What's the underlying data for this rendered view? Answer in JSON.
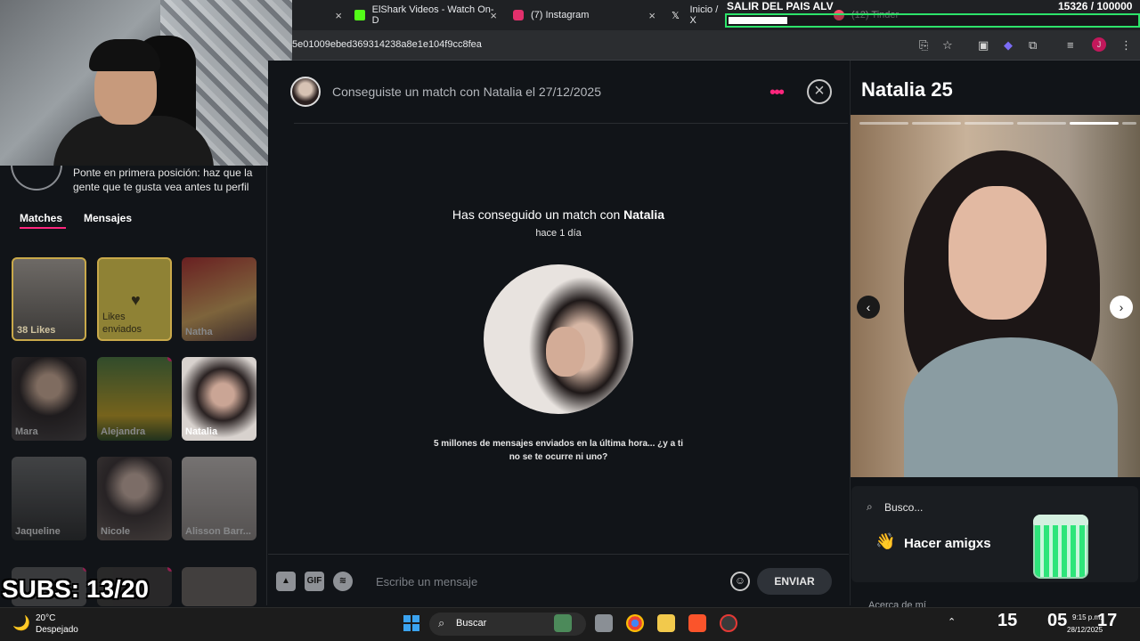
{
  "browser": {
    "tabs": [
      {
        "label": "ElShark Videos - Watch On-D",
        "icon_color": "#53fc18"
      },
      {
        "label": "(7) Instagram",
        "icon_color": "#e1306c"
      },
      {
        "label": "Inicio / X",
        "icon_color": "#ffffff"
      },
      {
        "label": "(12) Tinder",
        "icon_color": "#fd5068"
      }
    ],
    "url": "5e01009ebed369314238a8e1e104f9cc8fea"
  },
  "overlay": {
    "goal_title": "SALIR DEL PAIS ALV",
    "goal_count": "15326 / 100000",
    "goal_progress": 0.15326,
    "subs": "SUBS: 13/20"
  },
  "sidebar": {
    "promo_text": "Ponte en primera posición: haz que la gente que te gusta vea antes tu perfil",
    "tabs": {
      "matches": "Matches",
      "messages": "Mensajes"
    },
    "cards": [
      {
        "label": "38 Likes"
      },
      {
        "label": "Likes enviados"
      },
      {
        "label": "Natha"
      },
      {
        "label": "Mara"
      },
      {
        "label": "Alejandra"
      },
      {
        "label": "Natalia"
      },
      {
        "label": "Jaqueline"
      },
      {
        "label": "Nicole"
      },
      {
        "label": "Alisson Barr..."
      }
    ]
  },
  "chat": {
    "header": "Conseguiste un match con Natalia el 27/12/2025",
    "title_prefix": "Has conseguido un match con ",
    "title_name": "Natalia",
    "time": "hace 1 día",
    "hint": "5 millones de mensajes enviados en la última hora... ¿y a ti no se te ocurre ni uno?",
    "composer": {
      "gif_label": "GIF",
      "placeholder": "Escribe un mensaje",
      "send_label": "ENVIAR"
    },
    "accent": "#fd267d"
  },
  "profile": {
    "name": "Natalia",
    "age": "25",
    "busco_label": "Busco...",
    "busco_value": "Hacer amigxs",
    "about_label": "Acerca de mí"
  },
  "taskbar": {
    "weather_temp": "20°C",
    "weather_desc": "Despejado",
    "search_label": "Buscar",
    "hours": "15",
    "minutes": "05",
    "seconds": "17",
    "clock": "9:15 p.m.",
    "date": "28/12/2025"
  }
}
